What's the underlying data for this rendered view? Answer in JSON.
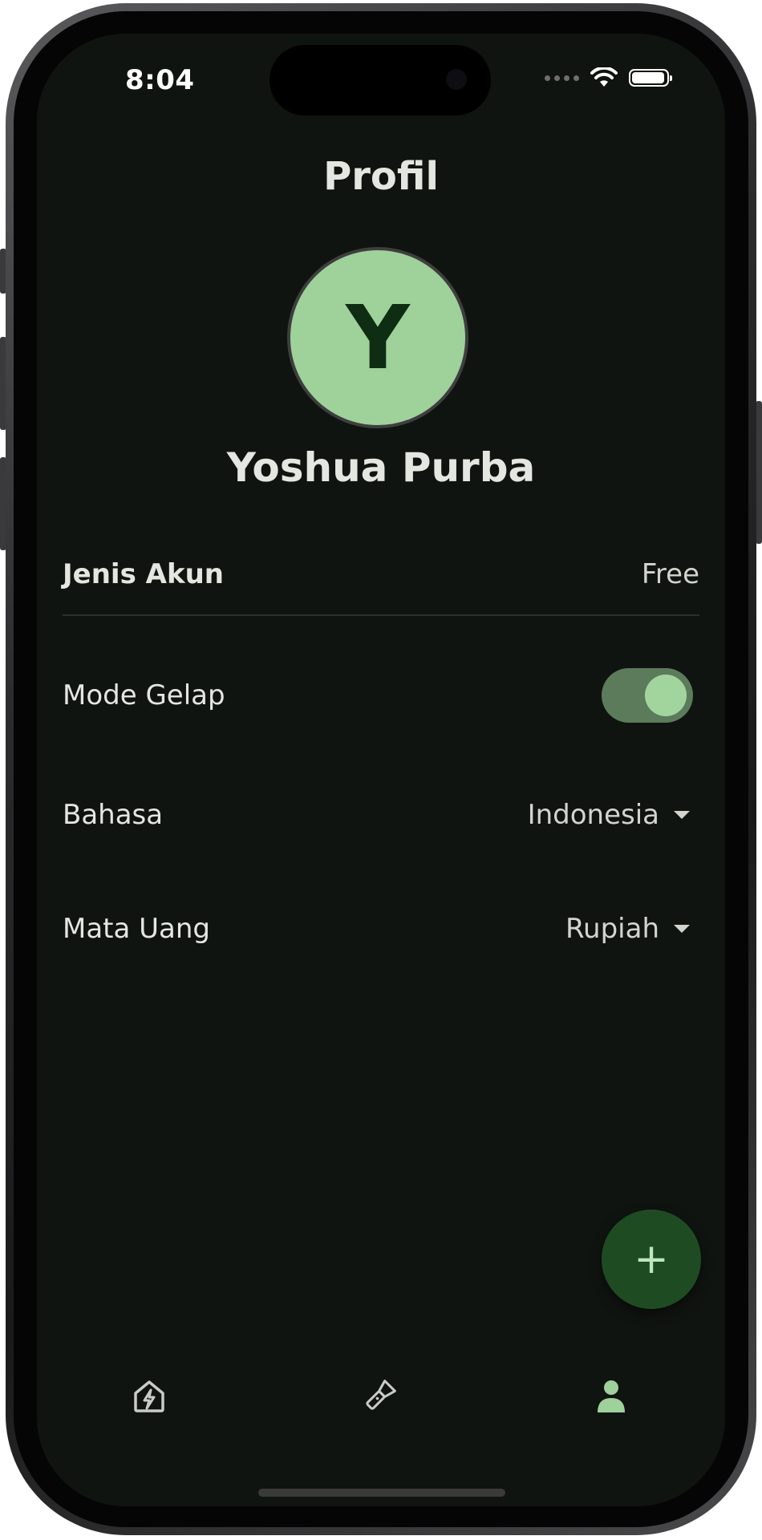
{
  "status_bar": {
    "time": "8:04"
  },
  "header": {
    "title": "Profil"
  },
  "profile": {
    "avatar_initial": "Y",
    "name": "Yoshua Purba"
  },
  "settings": {
    "account_type": {
      "label": "Jenis Akun",
      "value": "Free"
    },
    "dark_mode": {
      "label": "Mode Gelap",
      "enabled": true
    },
    "language": {
      "label": "Bahasa",
      "value": "Indonesia"
    },
    "currency": {
      "label": "Mata Uang",
      "value": "Rupiah"
    }
  },
  "fab": {
    "icon": "plus-icon",
    "symbol": "+"
  },
  "bottom_nav": {
    "items": [
      {
        "icon": "home-bolt-icon",
        "active": false
      },
      {
        "icon": "flashlight-icon",
        "active": false
      },
      {
        "icon": "person-icon",
        "active": true
      }
    ]
  },
  "colors": {
    "background": "#101410",
    "accent": "#9fd19b",
    "fab": "#1f4b22",
    "text": "#e4e6e0"
  }
}
